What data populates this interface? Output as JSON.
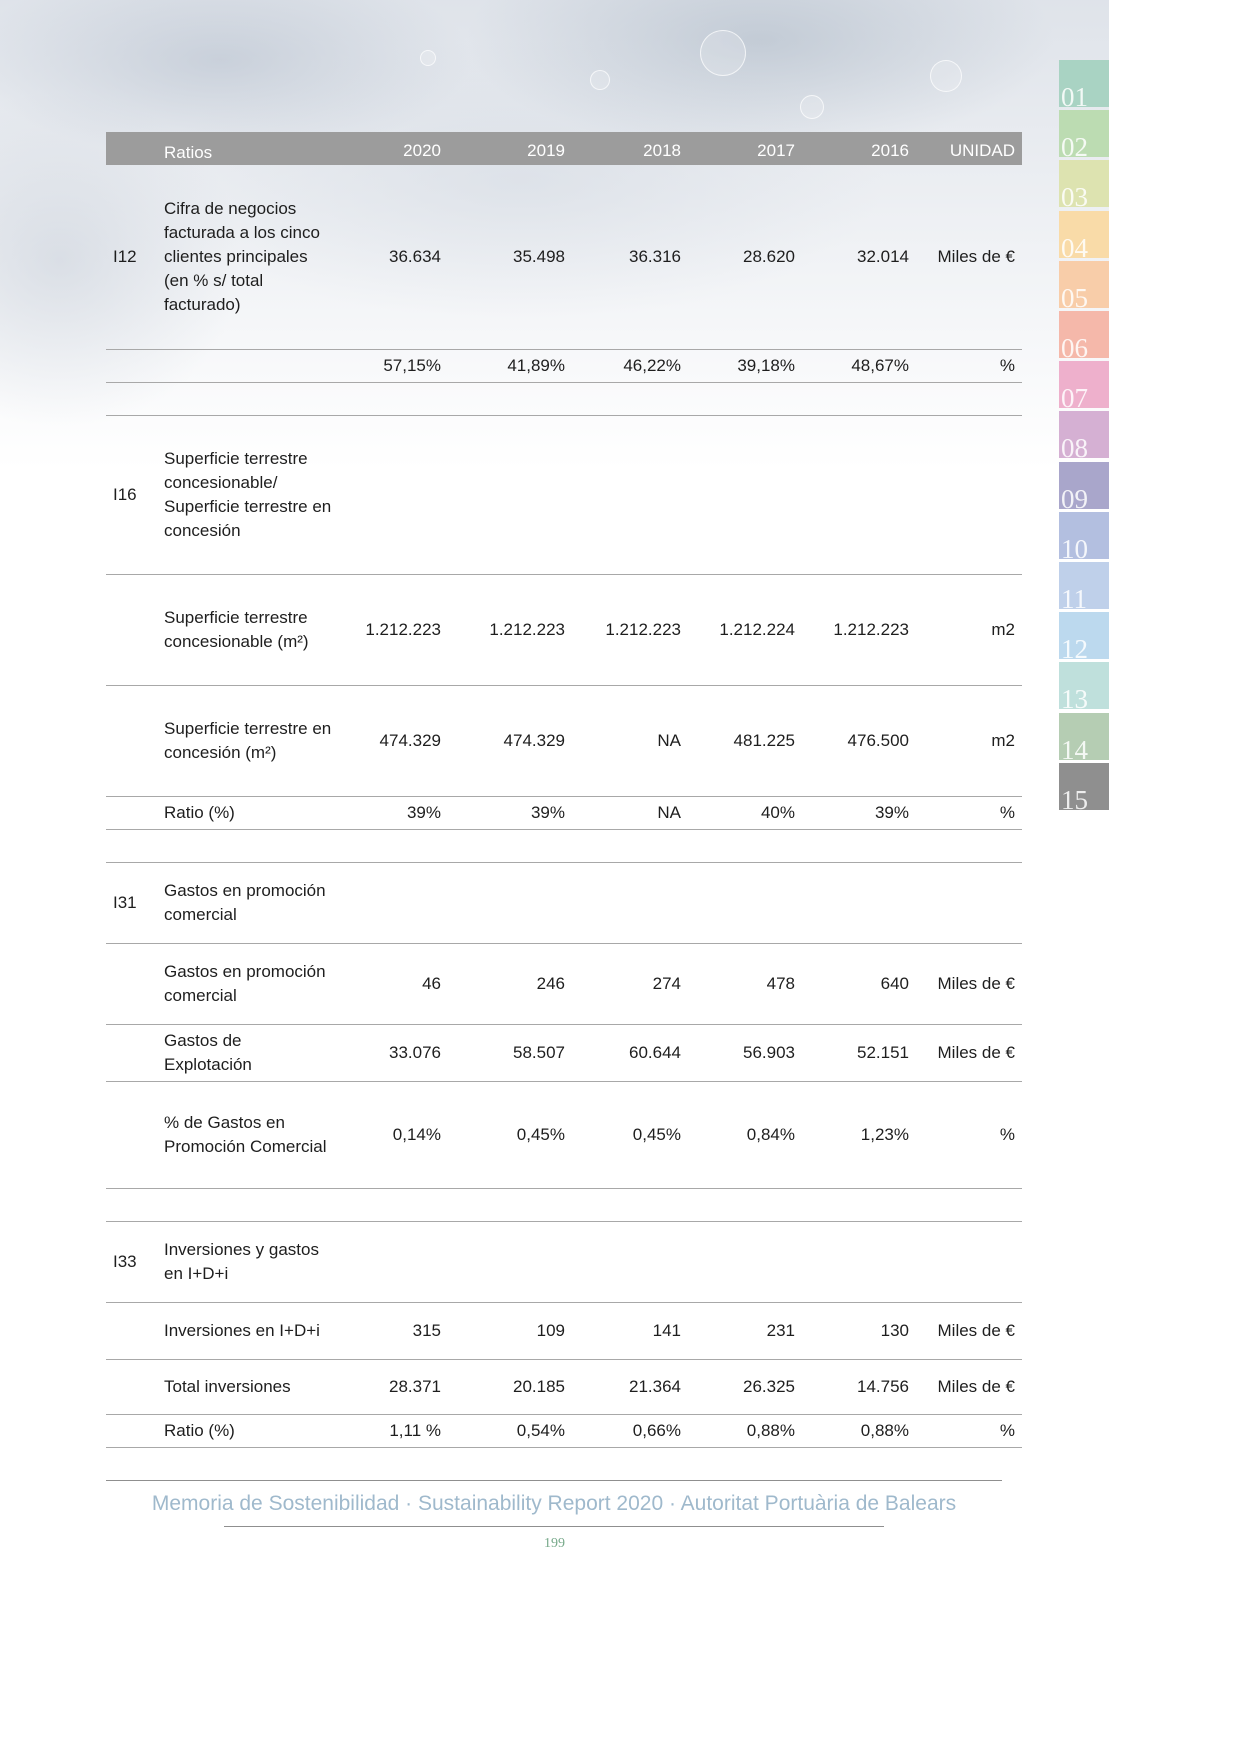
{
  "header": {
    "ratios": "Ratios",
    "y2020": "2020",
    "y2019": "2019",
    "y2018": "2018",
    "y2017": "2017",
    "y2016": "2016",
    "unidad": "UNIDAD"
  },
  "rows": [
    {
      "code": "I12",
      "label": "Cifra de negocios facturada a los cinco clientes principales (en % s/ total facturado)",
      "v2020": "36.634",
      "v2019": "35.498",
      "v2018": "36.316",
      "v2017": "28.620",
      "v2016": "32.014",
      "unit": "Miles de €"
    },
    {
      "code": "",
      "label": "",
      "v2020": "57,15%",
      "v2019": "41,89%",
      "v2018": "46,22%",
      "v2017": "39,18%",
      "v2016": "48,67%",
      "unit": "%"
    },
    {
      "code": "",
      "label": "",
      "v2020": "",
      "v2019": "",
      "v2018": "",
      "v2017": "",
      "v2016": "",
      "unit": ""
    },
    {
      "code": "I16",
      "label": "Superficie terrestre concesionable/ Superficie terrestre en concesión",
      "v2020": "",
      "v2019": "",
      "v2018": "",
      "v2017": "",
      "v2016": "",
      "unit": ""
    },
    {
      "code": "",
      "label": "Superficie terrestre concesionable (m²)",
      "v2020": "1.212.223",
      "v2019": "1.212.223",
      "v2018": "1.212.223",
      "v2017": "1.212.224",
      "v2016": "1.212.223",
      "unit": "m2"
    },
    {
      "code": "",
      "label": "Superficie terrestre en concesión (m²)",
      "v2020": "474.329",
      "v2019": "474.329",
      "v2018": "NA",
      "v2017": "481.225",
      "v2016": "476.500",
      "unit": "m2"
    },
    {
      "code": "",
      "label": "Ratio (%)",
      "v2020": "39%",
      "v2019": "39%",
      "v2018": "NA",
      "v2017": "40%",
      "v2016": "39%",
      "unit": "%"
    },
    {
      "code": "",
      "label": "",
      "v2020": "",
      "v2019": "",
      "v2018": "",
      "v2017": "",
      "v2016": "",
      "unit": ""
    },
    {
      "code": "I31",
      "label": "Gastos en promoción comercial",
      "v2020": "",
      "v2019": "",
      "v2018": "",
      "v2017": "",
      "v2016": "",
      "unit": ""
    },
    {
      "code": "",
      "label": "Gastos en promoción comercial",
      "v2020": "46",
      "v2019": "246",
      "v2018": "274",
      "v2017": "478",
      "v2016": "640",
      "unit": "Miles de €"
    },
    {
      "code": "",
      "label": "Gastos de Explotación",
      "v2020": "33.076",
      "v2019": "58.507",
      "v2018": "60.644",
      "v2017": "56.903",
      "v2016": "52.151",
      "unit": "Miles de €"
    },
    {
      "code": "",
      "label": "% de Gastos en Promoción Comercial",
      "v2020": "0,14%",
      "v2019": "0,45%",
      "v2018": "0,45%",
      "v2017": "0,84%",
      "v2016": "1,23%",
      "unit": "%"
    },
    {
      "code": "",
      "label": "",
      "v2020": "",
      "v2019": "",
      "v2018": "",
      "v2017": "",
      "v2016": "",
      "unit": ""
    },
    {
      "code": "I33",
      "label": "Inversiones y gastos en I+D+i",
      "v2020": "",
      "v2019": "",
      "v2018": "",
      "v2017": "",
      "v2016": "",
      "unit": ""
    },
    {
      "code": "",
      "label": "Inversiones en I+D+i",
      "v2020": "315",
      "v2019": "109",
      "v2018": "141",
      "v2017": "231",
      "v2016": "130",
      "unit": "Miles de €"
    },
    {
      "code": "",
      "label": "Total inversiones",
      "v2020": "28.371",
      "v2019": "20.185",
      "v2018": "21.364",
      "v2017": "26.325",
      "v2016": "14.756",
      "unit": "Miles de €"
    },
    {
      "code": "",
      "label": "Ratio (%)",
      "v2020": "1,11 %",
      "v2019": "0,54%",
      "v2018": "0,66%",
      "v2017": "0,88%",
      "v2016": "0,88%",
      "unit": "%"
    }
  ],
  "tabs": [
    {
      "label": "01",
      "color": "#a9d3c3"
    },
    {
      "label": "02",
      "color": "#bcdcb2"
    },
    {
      "label": "03",
      "color": "#dde3b0"
    },
    {
      "label": "04",
      "color": "#f9dba8"
    },
    {
      "label": "05",
      "color": "#f8cda9"
    },
    {
      "label": "06",
      "color": "#f5b8aa"
    },
    {
      "label": "07",
      "color": "#eeb0cc"
    },
    {
      "label": "08",
      "color": "#d5b0d3"
    },
    {
      "label": "09",
      "color": "#a9a6cb"
    },
    {
      "label": "10",
      "color": "#b3bfe0"
    },
    {
      "label": "11",
      "color": "#bfd0ea"
    },
    {
      "label": "12",
      "color": "#bcd9ee"
    },
    {
      "label": "13",
      "color": "#bfe0dc"
    },
    {
      "label": "14",
      "color": "#b5cdb3"
    },
    {
      "label": "15",
      "color": "#8f8f8f"
    }
  ],
  "footer": {
    "text": "Memoria de Sostenibilidad · Sustainability Report 2020 · Autoritat Portuària de Balears",
    "page": "199"
  }
}
